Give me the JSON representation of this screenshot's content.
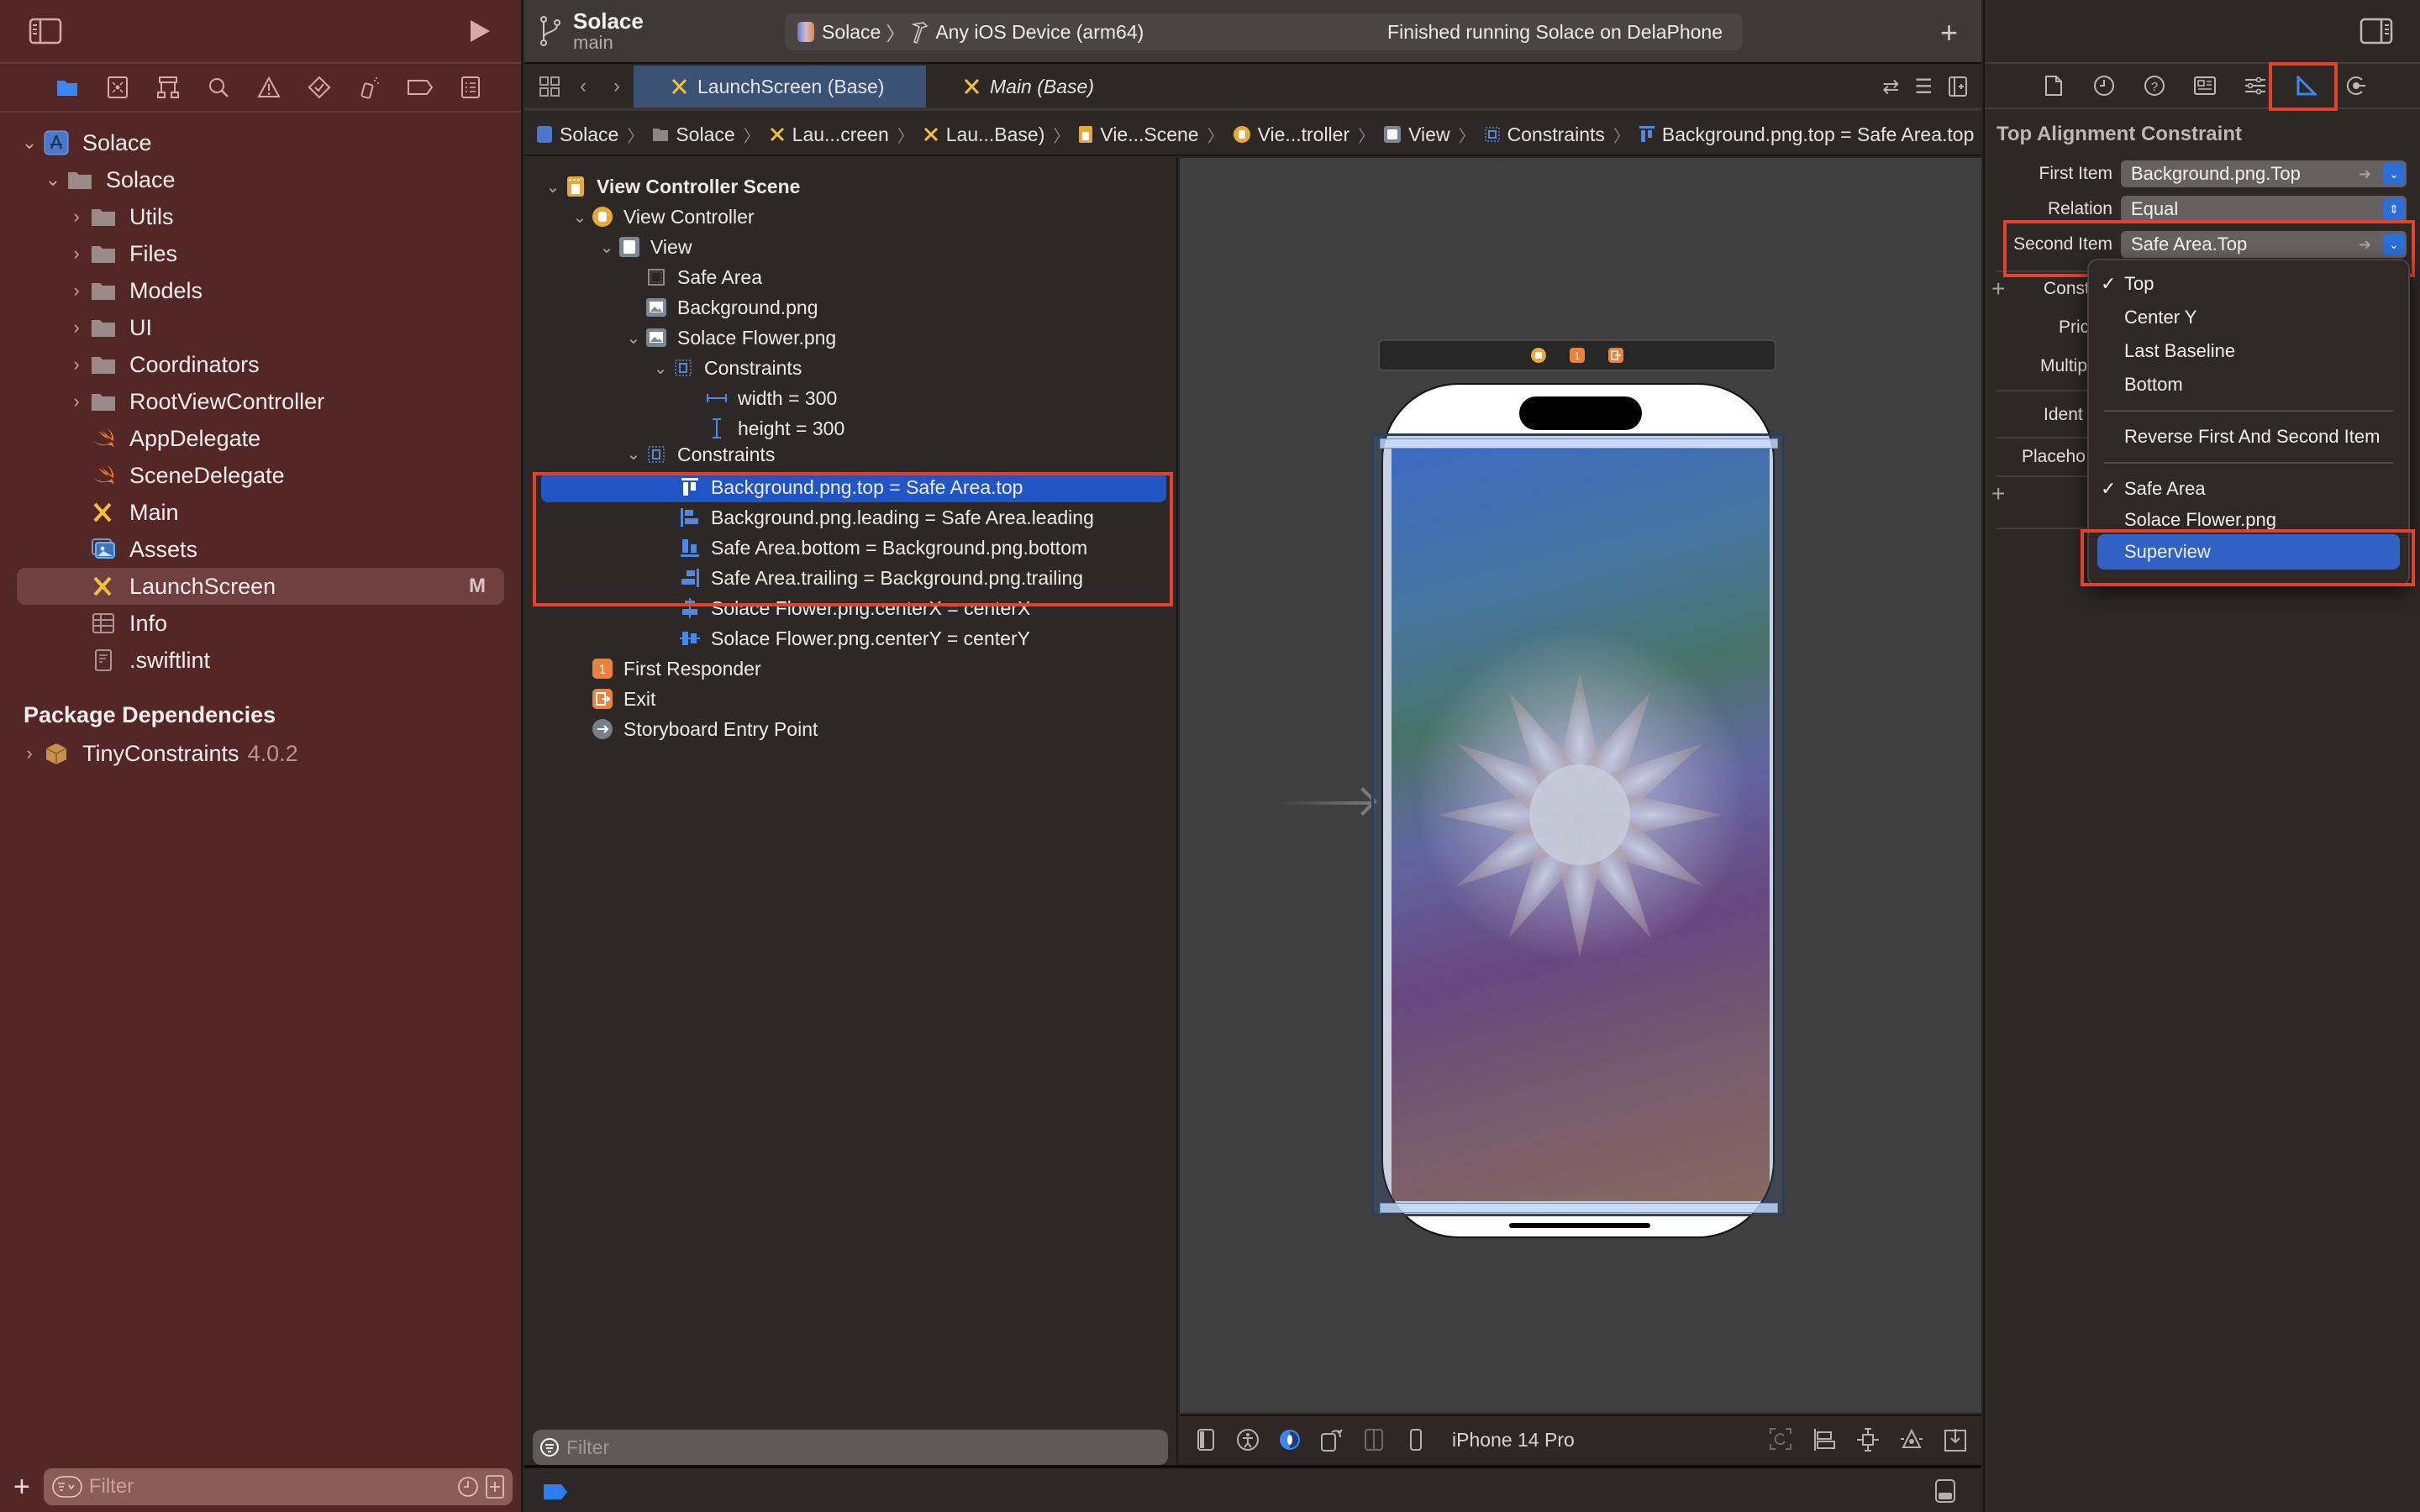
{
  "colors": {
    "accent": "#2a6ed6",
    "navigator_bg": "#532726",
    "selection_blue": "#2255c4",
    "highlight_red": "#e2412d"
  },
  "toolbar": {
    "project": "Solace",
    "branch": "main",
    "scheme": "Solace",
    "destination": "Any iOS Device (arm64)",
    "status": "Finished running Solace on DelaPhone"
  },
  "tabs": [
    {
      "label": "LaunchScreen (Base)",
      "active": true
    },
    {
      "label": "Main (Base)",
      "active": false
    }
  ],
  "jumpbar": [
    "Solace",
    "Solace",
    "Lau...creen",
    "Lau...Base)",
    "Vie...Scene",
    "Vie...troller",
    "View",
    "Constraints",
    "Background.png.top = Safe Area.top"
  ],
  "navigator": {
    "items": [
      {
        "label": "Solace",
        "type": "project",
        "expanded": true
      },
      {
        "label": "Solace",
        "type": "group",
        "expanded": true
      },
      {
        "label": "Utils",
        "type": "folder"
      },
      {
        "label": "Files",
        "type": "folder"
      },
      {
        "label": "Models",
        "type": "folder"
      },
      {
        "label": "UI",
        "type": "folder"
      },
      {
        "label": "Coordinators",
        "type": "folder"
      },
      {
        "label": "RootViewController",
        "type": "folder"
      },
      {
        "label": "AppDelegate",
        "type": "swift"
      },
      {
        "label": "SceneDelegate",
        "type": "swift"
      },
      {
        "label": "Main",
        "type": "storyboard"
      },
      {
        "label": "Assets",
        "type": "assets"
      },
      {
        "label": "LaunchScreen",
        "type": "storyboard",
        "selected": true,
        "badge": "M"
      },
      {
        "label": "Info",
        "type": "plist"
      },
      {
        "label": ".swiftlint",
        "type": "text"
      }
    ],
    "section": "Package Dependencies",
    "package": {
      "name": "TinyConstraints",
      "version": "4.0.2"
    },
    "filter_placeholder": "Filter"
  },
  "outline": {
    "items": [
      {
        "label": "View Controller Scene",
        "bold": true
      },
      {
        "label": "View Controller"
      },
      {
        "label": "View"
      },
      {
        "label": "Safe Area"
      },
      {
        "label": "Background.png"
      },
      {
        "label": "Solace Flower.png"
      },
      {
        "label": "Constraints"
      },
      {
        "label": "width = 300"
      },
      {
        "label": "height = 300"
      },
      {
        "label": "Constraints"
      },
      {
        "label": "Background.png.top = Safe Area.top",
        "selected": true
      },
      {
        "label": "Background.png.leading = Safe Area.leading"
      },
      {
        "label": "Safe Area.bottom = Background.png.bottom"
      },
      {
        "label": "Safe Area.trailing = Background.png.trailing"
      },
      {
        "label": "Solace Flower.png.centerX = centerX"
      },
      {
        "label": "Solace Flower.png.centerY = centerY"
      },
      {
        "label": "First Responder"
      },
      {
        "label": "Exit"
      },
      {
        "label": "Storyboard Entry Point"
      }
    ],
    "filter_placeholder": "Filter"
  },
  "canvas": {
    "device": "iPhone 14 Pro",
    "dock_icons": [
      "view-controller-icon",
      "first-responder-icon",
      "exit-icon"
    ]
  },
  "inspector": {
    "title": "Top Alignment Constraint",
    "first_item_label": "First Item",
    "first_item": "Background.png.Top",
    "relation_label": "Relation",
    "relation": "Equal",
    "second_item_label": "Second Item",
    "second_item": "Safe Area.Top",
    "partial_labels": [
      "Const",
      "Pric",
      "Multip",
      "Ident",
      "Placeho"
    ]
  },
  "menu": {
    "attributes": [
      {
        "label": "Top",
        "checked": true
      },
      {
        "label": "Center Y",
        "checked": false
      },
      {
        "label": "Last Baseline",
        "checked": false
      },
      {
        "label": "Bottom",
        "checked": false
      }
    ],
    "reverse": "Reverse First And Second Item",
    "items": [
      {
        "label": "Safe Area",
        "checked": true
      },
      {
        "label": "Solace Flower.png",
        "checked": false
      },
      {
        "label": "Superview",
        "checked": false,
        "highlighted": true
      }
    ],
    "check_glyph": "✓"
  }
}
